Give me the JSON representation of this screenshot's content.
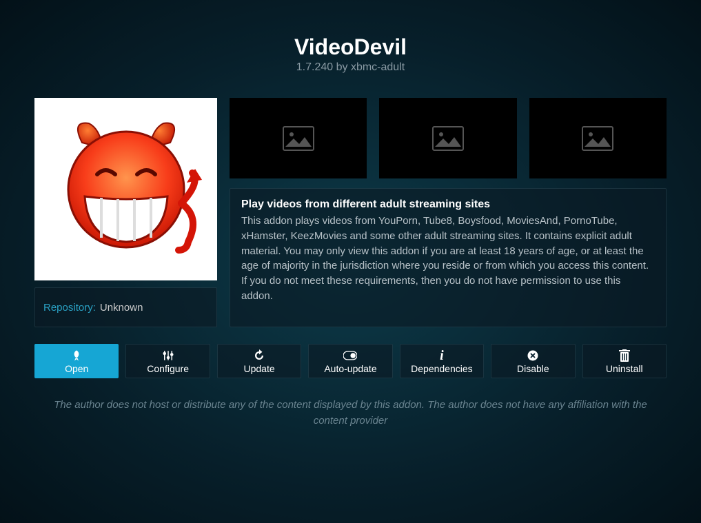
{
  "header": {
    "title": "VideoDevil",
    "subtitle": "1.7.240 by xbmc-adult"
  },
  "repository": {
    "label": "Repository:",
    "value": "Unknown"
  },
  "description": {
    "title": "Play videos from different adult streaming sites",
    "body": "This addon plays videos from YouPorn, Tube8, Boysfood, MoviesAnd, PornoTube, xHamster, KeezMovies and some other adult streaming sites. It contains explicit adult material. You may only view this addon if you are at least 18 years of age, or at least the age of majority in the jurisdiction where you reside or from which you access this content. If you do not meet these requirements, then you do not have permission to use this addon."
  },
  "actions": {
    "open": "Open",
    "configure": "Configure",
    "update": "Update",
    "autoupdate": "Auto-update",
    "dependencies": "Dependencies",
    "disable": "Disable",
    "uninstall": "Uninstall"
  },
  "disclaimer": "The author does not host or distribute any of the content displayed by this addon. The author does not have any affiliation with the content provider"
}
